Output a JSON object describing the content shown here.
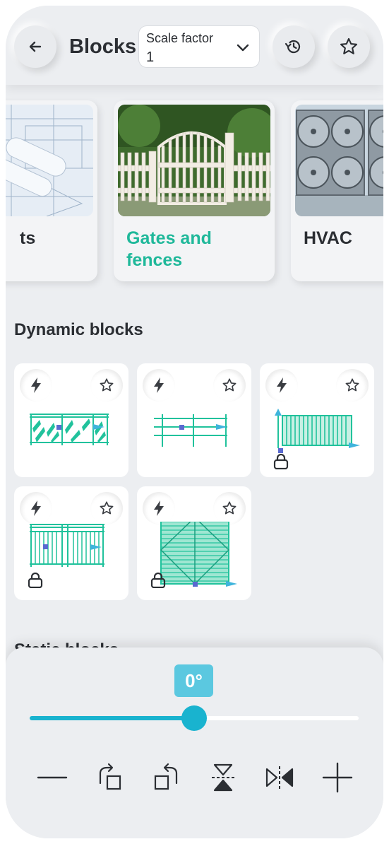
{
  "header": {
    "title": "Blocks",
    "back_icon": "arrow-left-icon",
    "scale": {
      "label": "Scale factor",
      "value": "1"
    },
    "history_icon": "history-icon",
    "favorite_icon": "star-icon"
  },
  "categories": [
    {
      "label": "ts",
      "active": false,
      "image": "blueprint-image"
    },
    {
      "label": "Gates and fences",
      "active": true,
      "image": "gate-image"
    },
    {
      "label": "HVAC",
      "active": false,
      "image": "hvac-image"
    }
  ],
  "dynamic_blocks": {
    "title": "Dynamic blocks",
    "items": [
      {
        "drawing": "glass-railing",
        "locked": false
      },
      {
        "drawing": "rail-fence",
        "locked": false
      },
      {
        "drawing": "slat-fence",
        "locked": true
      },
      {
        "drawing": "double-railing",
        "locked": true
      },
      {
        "drawing": "double-gate",
        "locked": true
      }
    ]
  },
  "static_blocks": {
    "title": "Static blocks"
  },
  "rotation": {
    "label": "0°",
    "value_fraction": 0.5
  },
  "tools": [
    {
      "icon": "line-icon"
    },
    {
      "icon": "rotate-right-icon"
    },
    {
      "icon": "rotate-left-icon"
    },
    {
      "icon": "flip-vertical-icon"
    },
    {
      "icon": "flip-horizontal-icon"
    },
    {
      "icon": "plus-icon"
    }
  ],
  "colors": {
    "accent": "#1fb89a",
    "slider": "#19b3cf",
    "drawing": "#21c29c",
    "handle": "#3fb4dc"
  }
}
